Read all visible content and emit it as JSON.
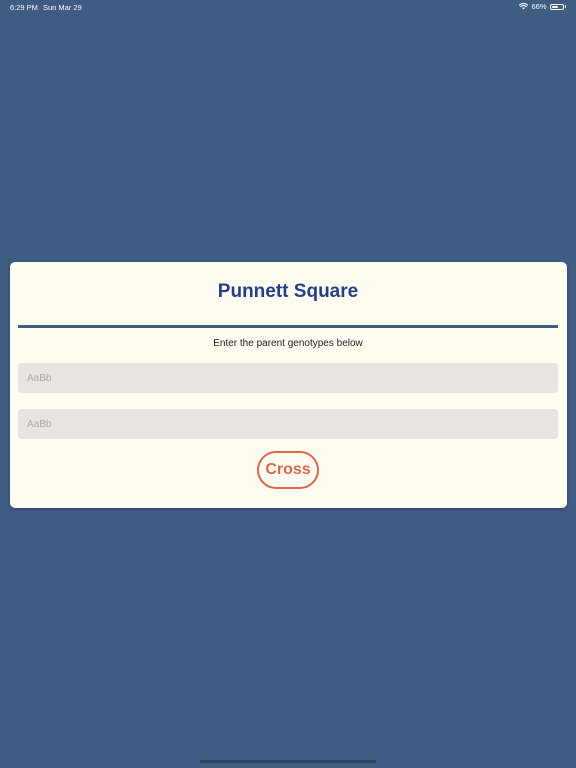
{
  "status_bar": {
    "time": "6:29 PM",
    "date": "Sun Mar 29",
    "battery": "66%",
    "battery_level": 0.66,
    "wifi_icon": "wifi-icon",
    "battery_icon": "battery-icon"
  },
  "card": {
    "title": "Punnett Square",
    "instructions": "Enter the parent genotypes below",
    "parent1": {
      "value": "",
      "placeholder": "AaBb"
    },
    "parent2": {
      "value": "",
      "placeholder": "AaBb"
    },
    "cross_label": "Cross"
  },
  "colors": {
    "background": "#3f5c82",
    "card": "#fffdf2",
    "title": "#233f86",
    "accent": "#e0654a",
    "input_bg": "#e7e4e1"
  }
}
